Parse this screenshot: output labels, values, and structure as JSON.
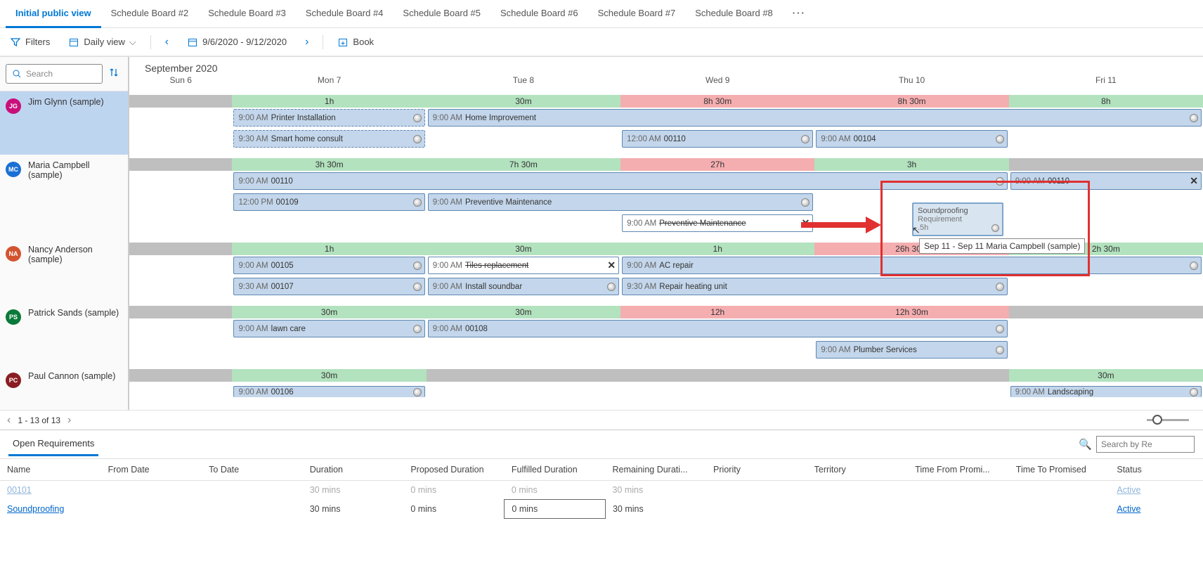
{
  "tabs": {
    "items": [
      "Initial public view",
      "Schedule Board #2",
      "Schedule Board #3",
      "Schedule Board #4",
      "Schedule Board #5",
      "Schedule Board #6",
      "Schedule Board #7",
      "Schedule Board #8"
    ],
    "more": "···"
  },
  "toolbar": {
    "filters": "Filters",
    "daily_view": "Daily view",
    "date_range": "9/6/2020 - 9/12/2020",
    "book": "Book"
  },
  "search": {
    "placeholder": "Search"
  },
  "month_label": "September 2020",
  "days": [
    "Sun 6",
    "Mon 7",
    "Tue 8",
    "Wed 9",
    "Thu 10",
    "Fri 11"
  ],
  "resources": [
    {
      "initials": "JG",
      "color": "#c9107a",
      "name": "Jim Glynn (sample)",
      "summary": [
        "",
        "1h",
        "30m",
        "8h 30m",
        "8h 30m",
        "8h"
      ],
      "summaryStyle": [
        "gray",
        "green",
        "green",
        "red",
        "red",
        "green"
      ],
      "bookings": [
        {
          "row": 0,
          "start": 1,
          "span": 1,
          "time": "9:00 AM",
          "label": "Printer Installation",
          "dashed": true
        },
        {
          "row": 0,
          "start": 2,
          "span": 4,
          "time": "9:00 AM",
          "label": "Home Improvement"
        },
        {
          "row": 1,
          "start": 1,
          "span": 1,
          "time": "9:30 AM",
          "label": "Smart home consult",
          "dashed": true
        },
        {
          "row": 1,
          "start": 3,
          "span": 1,
          "time": "12:00 AM",
          "label": "00110"
        },
        {
          "row": 1,
          "start": 4,
          "span": 1,
          "time": "9:00 AM",
          "label": "00104"
        }
      ]
    },
    {
      "initials": "MC",
      "color": "#1a6fd4",
      "name": "Maria Campbell (sample)",
      "summary": [
        "",
        "3h 30m",
        "7h 30m",
        "27h",
        "3h",
        ""
      ],
      "summaryStyle": [
        "gray",
        "green",
        "green",
        "red",
        "green",
        "gray"
      ],
      "bookings": [
        {
          "row": 0,
          "start": 1,
          "span": 4,
          "time": "9:00 AM",
          "label": "00110"
        },
        {
          "row": 0,
          "start": 5,
          "span": 1,
          "time": "9:00 AM",
          "label": "00110",
          "strike": true,
          "x": true,
          "white": false
        },
        {
          "row": 1,
          "start": 1,
          "span": 1,
          "time": "12:00 PM",
          "label": "00109"
        },
        {
          "row": 1,
          "start": 2,
          "span": 2,
          "time": "9:00 AM",
          "label": "Preventive Maintenance"
        },
        {
          "row": 2,
          "start": 3,
          "span": 1,
          "time": "9:00 AM",
          "label": "Preventive Maintenance",
          "strike": true,
          "x": true,
          "white": true
        }
      ]
    },
    {
      "initials": "NA",
      "color": "#d35330",
      "name": "Nancy Anderson (sample)",
      "summary": [
        "",
        "1h",
        "30m",
        "1h",
        "26h 30m",
        "2h 30m"
      ],
      "summaryStyle": [
        "gray",
        "green",
        "green",
        "green",
        "red",
        "green"
      ],
      "bookings": [
        {
          "row": 0,
          "start": 1,
          "span": 1,
          "time": "9:00 AM",
          "label": "00105"
        },
        {
          "row": 0,
          "start": 2,
          "span": 1,
          "time": "9:00 AM",
          "label": "Tiles replacement",
          "strike": true,
          "x": true,
          "white": true
        },
        {
          "row": 0,
          "start": 3,
          "span": 3,
          "time": "9:00 AM",
          "label": "AC repair"
        },
        {
          "row": 1,
          "start": 1,
          "span": 1,
          "time": "9:30 AM",
          "label": "00107"
        },
        {
          "row": 1,
          "start": 2,
          "span": 1,
          "time": "9:00 AM",
          "label": "Install soundbar"
        },
        {
          "row": 1,
          "start": 3,
          "span": 2,
          "time": "9:30 AM",
          "label": "Repair heating unit"
        }
      ]
    },
    {
      "initials": "PS",
      "color": "#0a7a3a",
      "name": "Patrick Sands (sample)",
      "summary": [
        "",
        "30m",
        "30m",
        "12h",
        "12h 30m",
        ""
      ],
      "summaryStyle": [
        "gray",
        "green",
        "green",
        "red",
        "red",
        "gray"
      ],
      "bookings": [
        {
          "row": 0,
          "start": 1,
          "span": 1,
          "time": "9:00 AM",
          "label": "lawn care"
        },
        {
          "row": 0,
          "start": 2,
          "span": 3,
          "time": "9:00 AM",
          "label": "00108"
        },
        {
          "row": 1,
          "start": 4,
          "span": 1,
          "time": "9:00 AM",
          "label": "Plumber Services"
        }
      ]
    },
    {
      "initials": "PC",
      "color": "#8a1d23",
      "name": "Paul Cannon (sample)",
      "summary": [
        "",
        "30m",
        "",
        "",
        "",
        "30m"
      ],
      "summaryStyle": [
        "gray",
        "green",
        "gray",
        "gray",
        "gray",
        "green"
      ],
      "bookings": [
        {
          "row": 0,
          "start": 1,
          "span": 1,
          "time": "9:00 AM",
          "label": "00106",
          "cut": true
        },
        {
          "row": 0,
          "start": 5,
          "span": 1,
          "time": "9:00 AM",
          "label": "Landscaping",
          "cut": true
        }
      ]
    }
  ],
  "drag": {
    "title": "Soundproofing",
    "sub": "Requirement",
    "dur": ".5h",
    "tip": "Sep 11 - Sep 11 Maria Campbell (sample)"
  },
  "pager": {
    "label": "1 - 13 of 13"
  },
  "bottom": {
    "tab": "Open Requirements",
    "search_placeholder": "Search by Re",
    "columns": [
      "Name",
      "From Date",
      "To Date",
      "Duration",
      "Proposed Duration",
      "Fulfilled Duration",
      "Remaining Durati...",
      "Priority",
      "Territory",
      "Time From Promi...",
      "Time To Promised",
      "Status"
    ],
    "rows": [
      {
        "name": "00101",
        "dur": "30 mins",
        "prop": "0 mins",
        "ful": "0 mins",
        "rem": "30 mins",
        "status": "Active",
        "dim": true
      },
      {
        "name": "Soundproofing",
        "dur": "30 mins",
        "prop": "0 mins",
        "ful": "0 mins",
        "rem": "30 mins",
        "status": "Active",
        "dim": false,
        "boxed": true
      }
    ]
  }
}
